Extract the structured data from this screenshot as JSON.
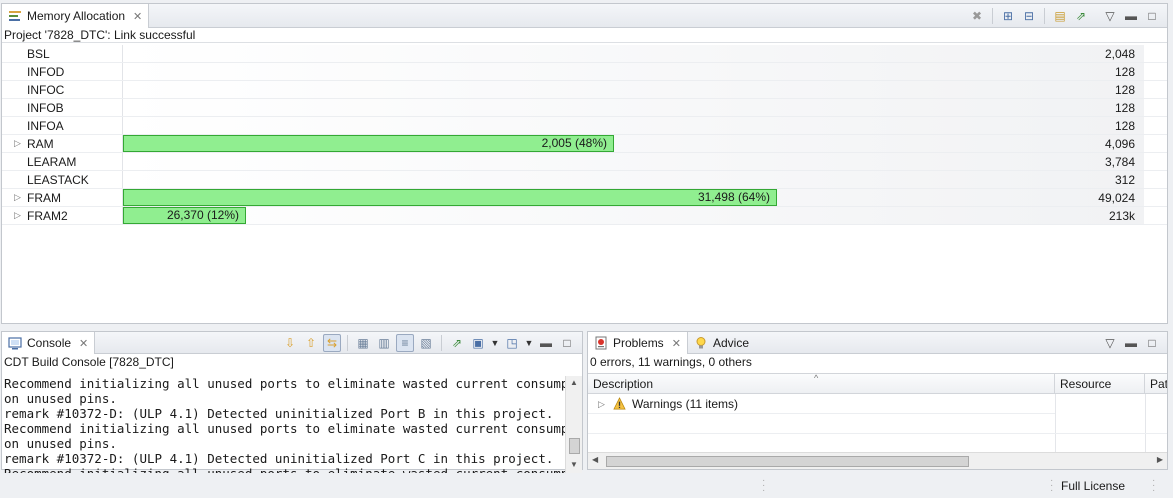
{
  "memory_view": {
    "tab_title": "Memory Allocation",
    "status": "Project '7828_DTC': Link successful",
    "rows": [
      {
        "name": "BSL",
        "expandable": false,
        "size": "2,048",
        "usage_label": "",
        "usage_fraction": 0
      },
      {
        "name": "INFOD",
        "expandable": false,
        "size": "128",
        "usage_label": "",
        "usage_fraction": 0
      },
      {
        "name": "INFOC",
        "expandable": false,
        "size": "128",
        "usage_label": "",
        "usage_fraction": 0
      },
      {
        "name": "INFOB",
        "expandable": false,
        "size": "128",
        "usage_label": "",
        "usage_fraction": 0
      },
      {
        "name": "INFOA",
        "expandable": false,
        "size": "128",
        "usage_label": "",
        "usage_fraction": 0
      },
      {
        "name": "RAM",
        "expandable": true,
        "size": "4,096",
        "usage_label": "2,005 (48%)",
        "usage_fraction": 0.48
      },
      {
        "name": "LEARAM",
        "expandable": false,
        "size": "3,784",
        "usage_label": "",
        "usage_fraction": 0
      },
      {
        "name": "LEASTACK",
        "expandable": false,
        "size": "312",
        "usage_label": "",
        "usage_fraction": 0
      },
      {
        "name": "FRAM",
        "expandable": true,
        "size": "49,024",
        "usage_label": "31,498 (64%)",
        "usage_fraction": 0.64
      },
      {
        "name": "FRAM2",
        "expandable": true,
        "size": "213k",
        "usage_label": "26,370 (12%)",
        "usage_fraction": 0.12
      }
    ]
  },
  "console_view": {
    "tab_title": "Console",
    "subtitle": "CDT Build Console [7828_DTC]",
    "lines": [
      "Recommend initializing all unused ports to eliminate wasted current consumption",
      "on unused pins.",
      "remark #10372-D: (ULP 4.1) Detected uninitialized Port B in this project.",
      "Recommend initializing all unused ports to eliminate wasted current consumption",
      "on unused pins.",
      "remark #10372-D: (ULP 4.1) Detected uninitialized Port C in this project.",
      "Recommend initializing all unused ports to eliminate wasted current consumption"
    ]
  },
  "problems_view": {
    "tab_title": "Problems",
    "advice_tab_title": "Advice",
    "summary": "0 errors, 11 warnings, 0 others",
    "columns": [
      "Description",
      "Resource",
      "Pat"
    ],
    "items": [
      {
        "label": "Warnings (11 items)"
      }
    ]
  },
  "status_bar": {
    "license": "Full License"
  },
  "colors": {
    "bar_fill": "#90ee90",
    "bar_border": "#34a834",
    "accent": "#4a6fa5"
  }
}
